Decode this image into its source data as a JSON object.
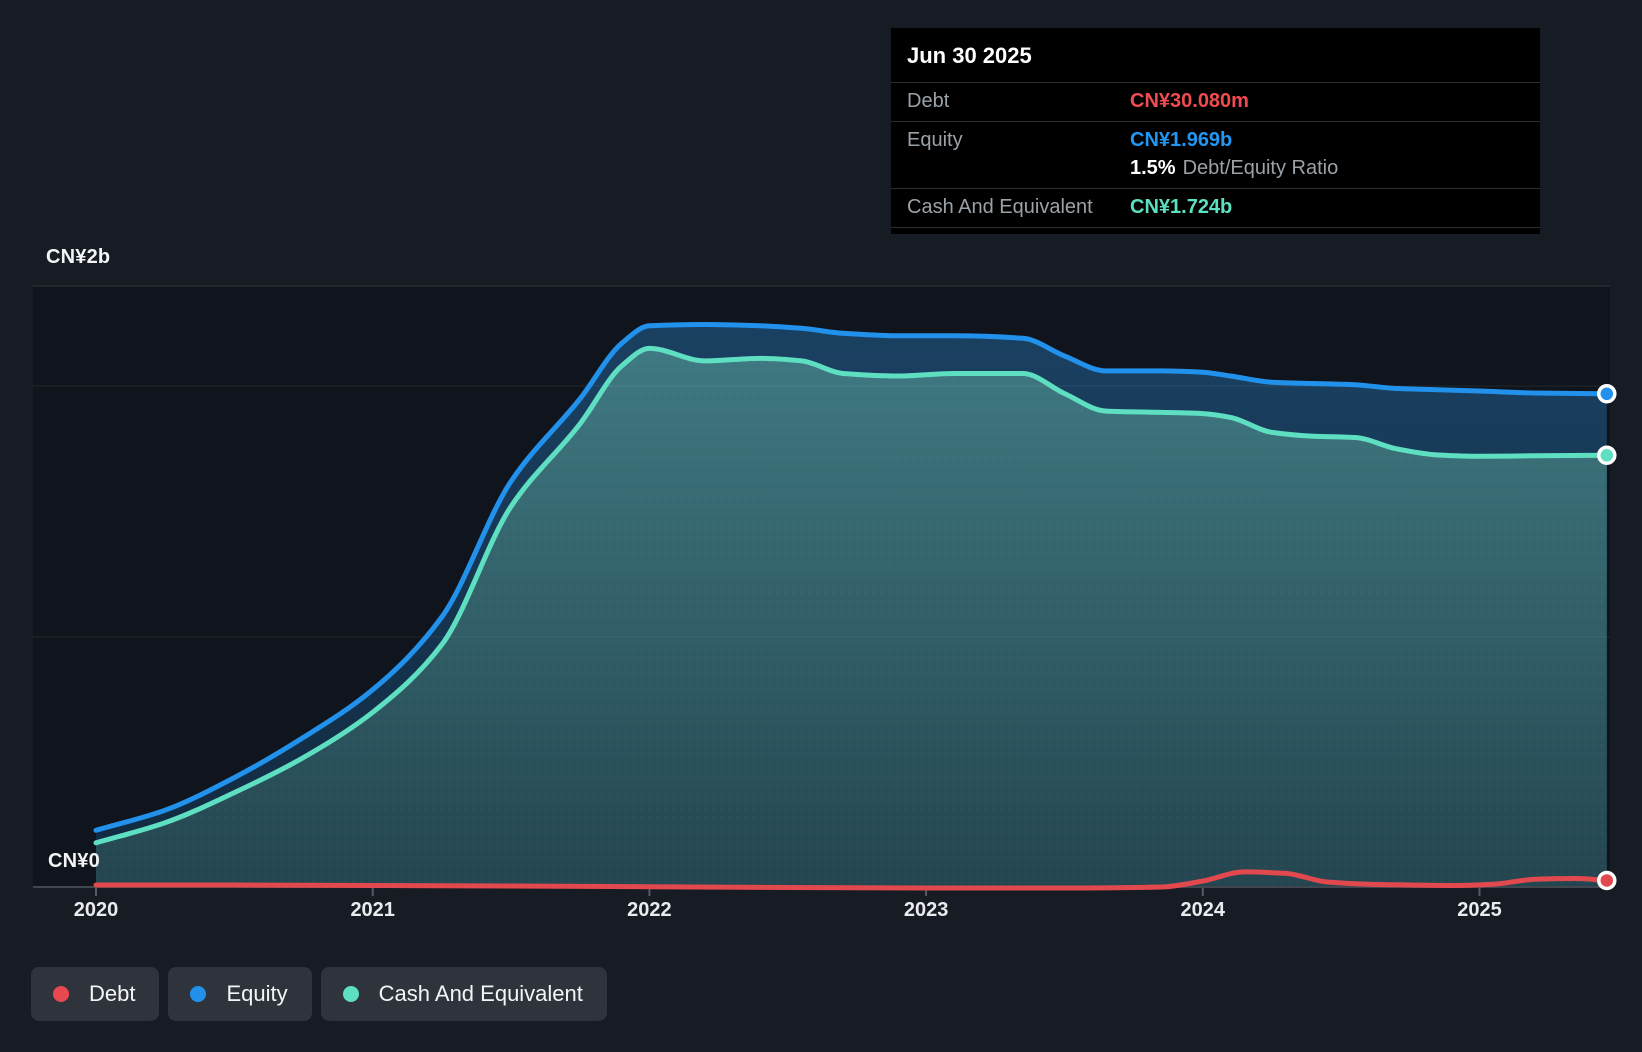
{
  "y_axis": {
    "max_label": "CN¥2b",
    "zero_label": "CN¥0"
  },
  "x_axis": {
    "labels": [
      "2020",
      "2021",
      "2022",
      "2023",
      "2024",
      "2025"
    ]
  },
  "tooltip": {
    "date": "Jun 30 2025",
    "debt_label": "Debt",
    "debt_value": "CN¥30.080m",
    "equity_label": "Equity",
    "equity_value": "CN¥1.969b",
    "ratio_value": "1.5%",
    "ratio_label": "Debt/Equity Ratio",
    "cash_label": "Cash And Equivalent",
    "cash_value": "CN¥1.724b"
  },
  "legend": {
    "items": [
      {
        "id": "debt",
        "label": "Debt",
        "color": "#e8484f"
      },
      {
        "id": "equity",
        "label": "Equity",
        "color": "#2191eb"
      },
      {
        "id": "cash",
        "label": "Cash And Equivalent",
        "color": "#5fdfc1"
      }
    ]
  },
  "colors": {
    "background": "#171b23",
    "plot_background": "#10141c",
    "debt_line": "#e2494f",
    "equity_line": "#2191eb",
    "cash_line": "#5fdfc1",
    "equity_fill_top": "#1b4264",
    "equity_fill_bottom": "#11293f",
    "cash_fill_top": "#427f88",
    "cash_fill_bottom": "#24454f",
    "axis_line": "#41474f",
    "gridline": "rgba(255,255,255,0.08)",
    "tooltip_background": "#000000",
    "legend_pill_background": "#2f343c"
  },
  "chart_data": {
    "type": "area",
    "x_labels": [
      "2020",
      "2021",
      "2022",
      "2023",
      "2024",
      "2025"
    ],
    "x_range": [
      2020,
      2025.46
    ],
    "ylabel": "CN¥ (billions)",
    "ylim": [
      0,
      2.4
    ],
    "gridlines_b": [
      1,
      2
    ],
    "legend_position": "bottom-left",
    "last_point_date": "Jun 30 2025",
    "series": [
      {
        "name": "Equity",
        "color": "#2191eb",
        "final_value_label": "CN¥1.969b",
        "points": [
          [
            2020.0,
            0.23
          ],
          [
            2020.25,
            0.31
          ],
          [
            2020.5,
            0.44
          ],
          [
            2020.75,
            0.6
          ],
          [
            2021.0,
            0.79
          ],
          [
            2021.25,
            1.08
          ],
          [
            2021.5,
            1.62
          ],
          [
            2021.75,
            1.95
          ],
          [
            2021.9,
            2.17
          ],
          [
            2022.0,
            2.24
          ],
          [
            2022.2,
            2.245
          ],
          [
            2022.4,
            2.24
          ],
          [
            2022.55,
            2.23
          ],
          [
            2022.7,
            2.21
          ],
          [
            2022.9,
            2.2
          ],
          [
            2023.1,
            2.2
          ],
          [
            2023.35,
            2.19
          ],
          [
            2023.5,
            2.12
          ],
          [
            2023.65,
            2.06
          ],
          [
            2023.85,
            2.06
          ],
          [
            2024.0,
            2.055
          ],
          [
            2024.1,
            2.04
          ],
          [
            2024.25,
            2.015
          ],
          [
            2024.4,
            2.01
          ],
          [
            2024.55,
            2.005
          ],
          [
            2024.7,
            1.99
          ],
          [
            2024.85,
            1.985
          ],
          [
            2025.0,
            1.98
          ],
          [
            2025.2,
            1.972
          ],
          [
            2025.46,
            1.969
          ]
        ]
      },
      {
        "name": "Cash And Equivalent",
        "color": "#5fdfc1",
        "final_value_label": "CN¥1.724b",
        "points": [
          [
            2020.0,
            0.18
          ],
          [
            2020.25,
            0.26
          ],
          [
            2020.5,
            0.38
          ],
          [
            2020.75,
            0.52
          ],
          [
            2021.0,
            0.7
          ],
          [
            2021.25,
            0.97
          ],
          [
            2021.5,
            1.52
          ],
          [
            2021.75,
            1.85
          ],
          [
            2021.9,
            2.08
          ],
          [
            2022.0,
            2.15
          ],
          [
            2022.2,
            2.1
          ],
          [
            2022.4,
            2.11
          ],
          [
            2022.55,
            2.1
          ],
          [
            2022.7,
            2.05
          ],
          [
            2022.9,
            2.04
          ],
          [
            2023.1,
            2.05
          ],
          [
            2023.35,
            2.05
          ],
          [
            2023.5,
            1.97
          ],
          [
            2023.65,
            1.9
          ],
          [
            2023.85,
            1.895
          ],
          [
            2024.0,
            1.89
          ],
          [
            2024.1,
            1.875
          ],
          [
            2024.25,
            1.815
          ],
          [
            2024.4,
            1.8
          ],
          [
            2024.55,
            1.795
          ],
          [
            2024.7,
            1.75
          ],
          [
            2024.85,
            1.725
          ],
          [
            2025.0,
            1.72
          ],
          [
            2025.2,
            1.722
          ],
          [
            2025.46,
            1.724
          ]
        ]
      },
      {
        "name": "Debt",
        "color": "#e2494f",
        "final_value_label": "CN¥30.080m",
        "points": [
          [
            2020.0,
            0.012
          ],
          [
            2020.5,
            0.012
          ],
          [
            2021.0,
            0.01
          ],
          [
            2021.5,
            0.008
          ],
          [
            2022.0,
            0.005
          ],
          [
            2022.5,
            0.002
          ],
          [
            2023.0,
            0.0
          ],
          [
            2023.5,
            0.0
          ],
          [
            2023.85,
            0.004
          ],
          [
            2024.0,
            0.028
          ],
          [
            2024.15,
            0.064
          ],
          [
            2024.3,
            0.058
          ],
          [
            2024.45,
            0.024
          ],
          [
            2024.6,
            0.015
          ],
          [
            2024.75,
            0.012
          ],
          [
            2024.9,
            0.01
          ],
          [
            2025.05,
            0.015
          ],
          [
            2025.2,
            0.035
          ],
          [
            2025.35,
            0.038
          ],
          [
            2025.46,
            0.03
          ]
        ]
      }
    ]
  }
}
